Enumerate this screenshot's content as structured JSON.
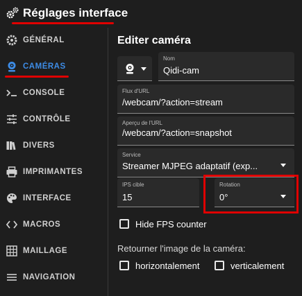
{
  "header": {
    "title": "Réglages interface"
  },
  "sidebar": {
    "items": [
      {
        "label": "GÉNÉRAL"
      },
      {
        "label": "CAMÉRAS"
      },
      {
        "label": "CONSOLE"
      },
      {
        "label": "CONTRÔLE"
      },
      {
        "label": "DIVERS"
      },
      {
        "label": "IMPRIMANTES"
      },
      {
        "label": "INTERFACE"
      },
      {
        "label": "MACROS"
      },
      {
        "label": "MAILLAGE"
      },
      {
        "label": "NAVIGATION"
      }
    ],
    "active_index": 1
  },
  "editor": {
    "title": "Editer caméra",
    "name": {
      "label": "Nom",
      "value": "Qidi-cam"
    },
    "stream_url": {
      "label": "Flux d'URL",
      "value": "/webcam/?action=stream"
    },
    "snapshot_url": {
      "label": "Aperçu de l'URL",
      "value": "/webcam/?action=snapshot"
    },
    "service": {
      "label": "Service",
      "value": "Streamer MJPEG adaptatif (exp..."
    },
    "target_fps": {
      "label": "IPS cible",
      "value": "15"
    },
    "rotation": {
      "label": "Rotation",
      "value": "0°"
    },
    "hide_fps": {
      "label": "Hide FPS counter",
      "checked": false
    },
    "flip_heading": "Retourner l'image de la caméra:",
    "flip_horizontal": {
      "label": "horizontalement",
      "checked": false
    },
    "flip_vertical": {
      "label": "verticalement",
      "checked": false
    }
  },
  "colors": {
    "accent": "#3d8ce6",
    "highlight": "#e00000",
    "background": "#1e1e1e",
    "field": "#2a2a2a"
  }
}
